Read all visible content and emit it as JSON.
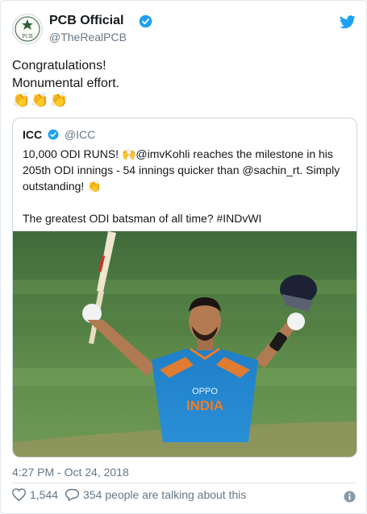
{
  "tweet": {
    "author_name": "PCB Official",
    "author_handle": "@TheRealPCB",
    "avatar_text": "PCB",
    "text_lines": [
      "Congratulations!",
      "Monumental effort."
    ],
    "emojis": [
      "👏",
      "👏",
      "👏"
    ],
    "timestamp": "4:27 PM - Oct 24, 2018",
    "like_count": "1,544",
    "talking_text": "354 people are talking about this"
  },
  "quoted": {
    "author_name": "ICC",
    "author_handle": "@ICC",
    "lines": [
      "10,000 ODI RUNS! 🙌@imvKohli reaches the milestone in his",
      "205th ODI innings - 54 innings quicker than @sachin_rt. Simply",
      "outstanding! 👏",
      "",
      "The greatest ODI batsman of all time? #INDvWI"
    ],
    "jersey_brand": "OPPO",
    "jersey_team": "INDIA"
  },
  "colors": {
    "twitter_blue": "#1da1f2",
    "text": "#14171a",
    "secondary": "#657786",
    "border": "#e1e8ed"
  },
  "icons": [
    "verified-badge-icon",
    "twitter-bird-icon",
    "heart-icon",
    "reply-bubble-icon",
    "info-icon"
  ]
}
